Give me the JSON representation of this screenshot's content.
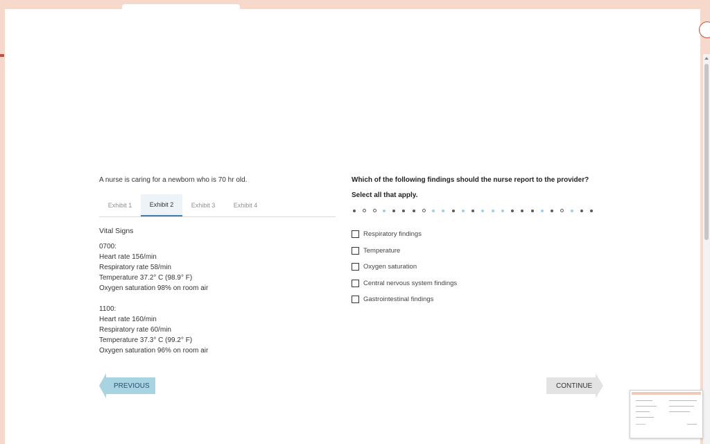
{
  "intro": "A nurse is caring for a newborn who is 70 hr old.",
  "tabs": [
    {
      "label": "Exhibit 1",
      "active": false
    },
    {
      "label": "Exhibit 2",
      "active": true
    },
    {
      "label": "Exhibit 3",
      "active": false
    },
    {
      "label": "Exhibit 4",
      "active": false
    }
  ],
  "exhibit": {
    "heading": "Vital Signs",
    "blocks": [
      {
        "time": "0700:",
        "lines": [
          "Heart rate 156/min",
          "Respiratory rate 58/min",
          "Temperature 37.2° C (98.9° F)",
          "Oxygen saturation 98% on room air"
        ]
      },
      {
        "time": "1100:",
        "lines": [
          "Heart rate 160/min",
          "Respiratory rate 60/min",
          "Temperature 37.3° C (99.2° F)",
          "Oxygen saturation 96% on room air"
        ]
      }
    ]
  },
  "question": "Which of the following findings should the nurse report to the provider?",
  "instruction": "Select all that apply.",
  "progress_dots": [
    "dark",
    "ring",
    "ring",
    "light",
    "dark",
    "dark",
    "dark",
    "ring",
    "light",
    "light",
    "dark",
    "light",
    "dark",
    "light",
    "light",
    "light",
    "dark",
    "dark",
    "dark",
    "light",
    "dark",
    "ring",
    "light",
    "dark",
    "dark"
  ],
  "dot_colors": {
    "dark": "#5a5a5a",
    "light": "#9ccfe6"
  },
  "options": [
    {
      "label": "Respiratory findings",
      "checked": false
    },
    {
      "label": "Temperature",
      "checked": false
    },
    {
      "label": "Oxygen saturation",
      "checked": false
    },
    {
      "label": "Central nervous system findings",
      "checked": false
    },
    {
      "label": "Gastrointestinal findings",
      "checked": false
    }
  ],
  "buttons": {
    "previous": "PREVIOUS",
    "continue": "CONTINUE"
  },
  "colors": {
    "previous_bg": "#a8d3e1",
    "continue_bg": "#e3e3e3",
    "accent": "#3f7fb1",
    "frame": "#f6d9cb"
  }
}
